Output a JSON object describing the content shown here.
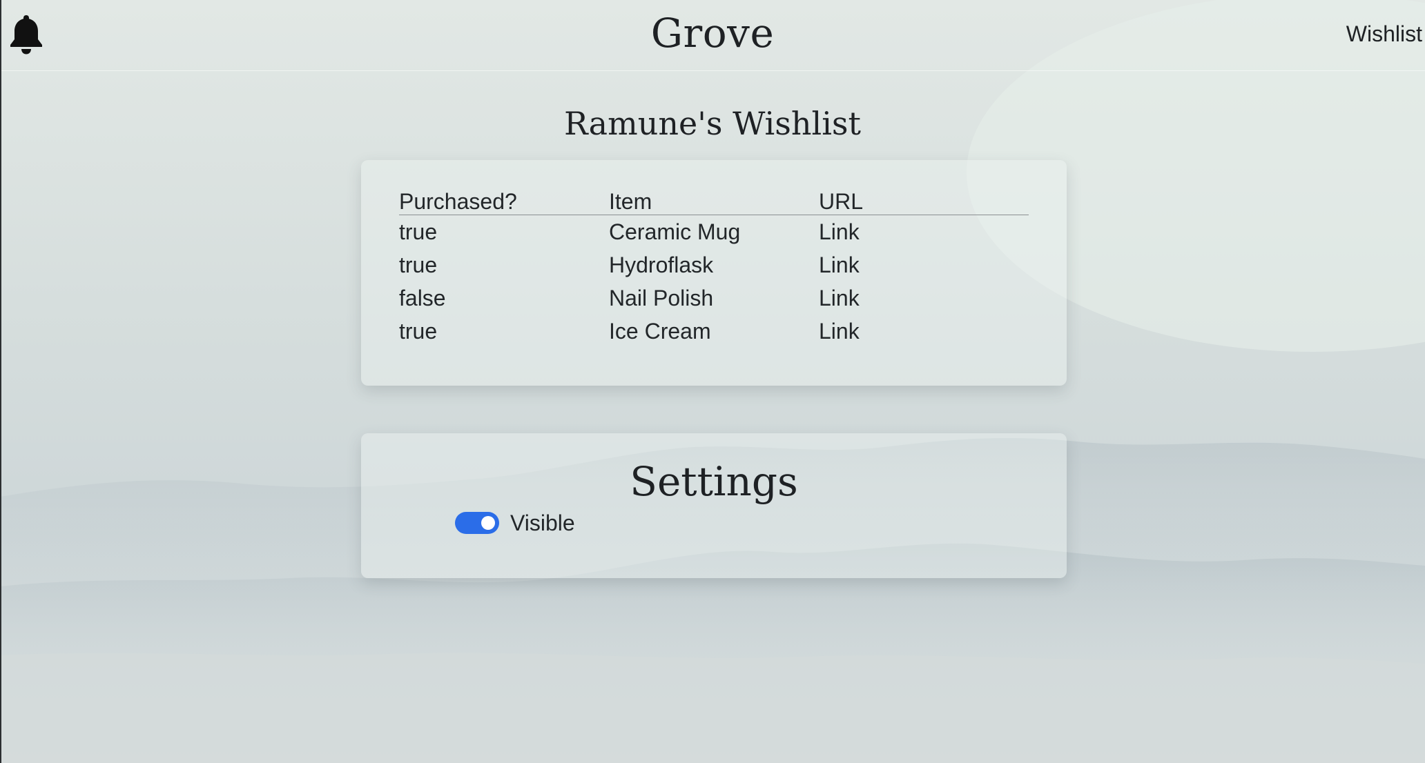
{
  "header": {
    "brand": "Grove",
    "nav_link": "Wishlist",
    "bell_icon": "bell-icon"
  },
  "wishlist": {
    "title": "Ramune's Wishlist",
    "columns": [
      "Purchased?",
      "Item",
      "URL"
    ],
    "rows": [
      {
        "purchased": "true",
        "item": "Ceramic Mug",
        "url_label": "Link"
      },
      {
        "purchased": "true",
        "item": "Hydroflask",
        "url_label": "Link"
      },
      {
        "purchased": "false",
        "item": "Nail Polish",
        "url_label": "Link"
      },
      {
        "purchased": "true",
        "item": "Ice Cream",
        "url_label": "Link"
      }
    ]
  },
  "settings": {
    "title": "Settings",
    "visible_label": "Visible",
    "visible_on": true
  },
  "colors": {
    "accent": "#2b6de8",
    "text": "#1e2124",
    "background": "#d4dcdc"
  }
}
